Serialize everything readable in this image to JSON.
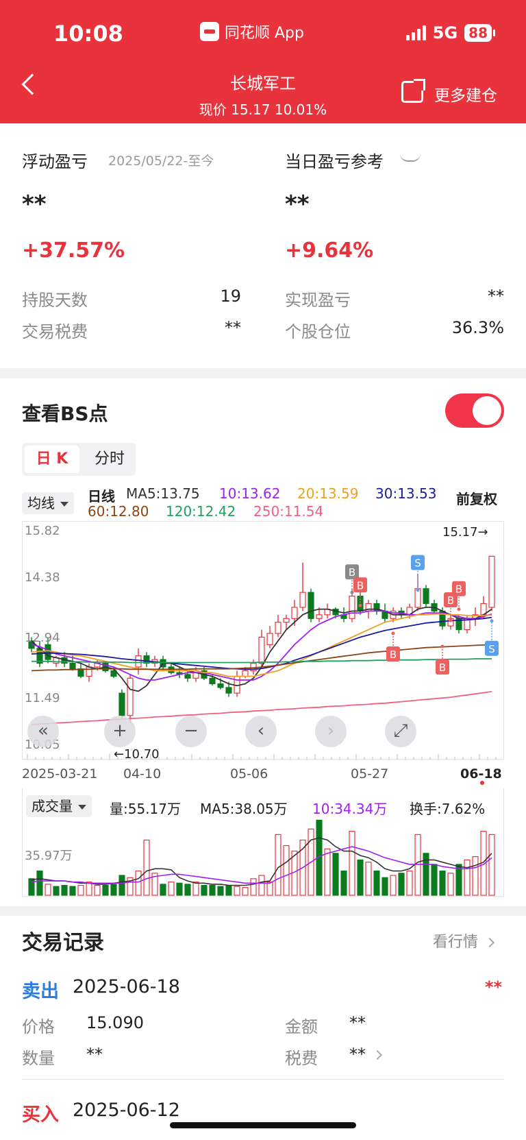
{
  "status": {
    "time": "10:08",
    "app": "同花顺 App",
    "network": "5G",
    "battery": "88"
  },
  "header": {
    "title": "长城军工",
    "subtitle": "现价 15.17 10.01%",
    "more_label": "更多建仓"
  },
  "summary": {
    "float_label": "浮动盈亏",
    "float_period": "2025/05/22-至今",
    "float_value": "**",
    "float_pct": "+37.57%",
    "daily_label": "当日盈亏参考",
    "daily_value": "**",
    "daily_pct": "+9.64%",
    "rows": [
      {
        "label": "持股天数",
        "value": "19",
        "label2": "实现盈亏",
        "value2": "**"
      },
      {
        "label": "交易税费",
        "value": "**",
        "label2": "个股仓位",
        "value2": "36.3%"
      }
    ]
  },
  "bs": {
    "title": "查看BS点",
    "toggle_on": true
  },
  "tabs": [
    {
      "label": "日 K",
      "active": true
    },
    {
      "label": "分时",
      "active": false
    }
  ],
  "kline": {
    "indicator": "均线",
    "line_label": "日线",
    "adjust": "前复权",
    "ma": [
      {
        "label": "MA5:13.75",
        "color": "#333333"
      },
      {
        "label": "10:13.62",
        "color": "#a020f0"
      },
      {
        "label": "20:13.59",
        "color": "#f0a020"
      },
      {
        "label": "30:13.53",
        "color": "#1a1aa0"
      },
      {
        "label": "60:12.80",
        "color": "#8b4513"
      },
      {
        "label": "120:12.42",
        "color": "#20a060"
      },
      {
        "label": "250:11.54",
        "color": "#f06080"
      }
    ],
    "price_ticks": [
      "15.82",
      "14.38",
      "12.94",
      "11.49",
      "10.05"
    ],
    "high_label": "15.17→",
    "low_label": "←10.70",
    "dates": [
      "2025-03-21",
      "04-10",
      "05-06",
      "05-27",
      "06-18"
    ]
  },
  "chart_data": {
    "type": "candlestick",
    "title": "",
    "xlabel": "",
    "ylabel": "",
    "ylim": [
      10.05,
      15.82
    ],
    "candles": [
      {
        "o": 12.9,
        "h": 13.0,
        "l": 12.6,
        "c": 12.7
      },
      {
        "o": 12.7,
        "h": 12.9,
        "l": 12.2,
        "c": 12.3
      },
      {
        "o": 12.8,
        "h": 13.0,
        "l": 12.3,
        "c": 12.4
      },
      {
        "o": 12.3,
        "h": 12.5,
        "l": 12.2,
        "c": 12.45
      },
      {
        "o": 12.45,
        "h": 12.6,
        "l": 12.2,
        "c": 12.3
      },
      {
        "o": 12.3,
        "h": 12.5,
        "l": 12.1,
        "c": 12.15
      },
      {
        "o": 12.15,
        "h": 12.3,
        "l": 11.9,
        "c": 11.95
      },
      {
        "o": 11.95,
        "h": 12.3,
        "l": 11.8,
        "c": 12.2
      },
      {
        "o": 12.2,
        "h": 12.4,
        "l": 12.1,
        "c": 12.3
      },
      {
        "o": 12.3,
        "h": 12.35,
        "l": 12.05,
        "c": 12.1
      },
      {
        "o": 12.1,
        "h": 12.2,
        "l": 11.9,
        "c": 11.95
      },
      {
        "o": 11.5,
        "h": 11.6,
        "l": 10.8,
        "c": 10.9
      },
      {
        "o": 10.9,
        "h": 12.0,
        "l": 10.7,
        "c": 11.9
      },
      {
        "o": 12.2,
        "h": 12.7,
        "l": 12.0,
        "c": 12.5
      },
      {
        "o": 12.5,
        "h": 12.6,
        "l": 12.2,
        "c": 12.3
      },
      {
        "o": 12.3,
        "h": 12.5,
        "l": 12.2,
        "c": 12.4
      },
      {
        "o": 12.4,
        "h": 12.5,
        "l": 12.1,
        "c": 12.2
      },
      {
        "o": 12.2,
        "h": 12.3,
        "l": 12.0,
        "c": 12.05
      },
      {
        "o": 12.05,
        "h": 12.2,
        "l": 11.9,
        "c": 12.0
      },
      {
        "o": 12.0,
        "h": 12.1,
        "l": 11.8,
        "c": 11.9
      },
      {
        "o": 11.9,
        "h": 12.2,
        "l": 11.8,
        "c": 12.1
      },
      {
        "o": 12.1,
        "h": 12.2,
        "l": 11.85,
        "c": 11.9
      },
      {
        "o": 11.9,
        "h": 12.0,
        "l": 11.7,
        "c": 11.75
      },
      {
        "o": 11.75,
        "h": 11.9,
        "l": 11.6,
        "c": 11.65
      },
      {
        "o": 11.65,
        "h": 11.8,
        "l": 11.4,
        "c": 11.5
      },
      {
        "o": 11.5,
        "h": 12.1,
        "l": 11.4,
        "c": 11.95
      },
      {
        "o": 11.95,
        "h": 12.2,
        "l": 11.9,
        "c": 12.1
      },
      {
        "o": 12.1,
        "h": 12.4,
        "l": 12.0,
        "c": 12.3
      },
      {
        "o": 12.3,
        "h": 13.2,
        "l": 12.2,
        "c": 13.0
      },
      {
        "o": 12.8,
        "h": 13.3,
        "l": 12.7,
        "c": 13.1
      },
      {
        "o": 13.1,
        "h": 13.6,
        "l": 13.0,
        "c": 13.4
      },
      {
        "o": 13.4,
        "h": 13.6,
        "l": 13.2,
        "c": 13.5
      },
      {
        "o": 13.5,
        "h": 14.0,
        "l": 13.3,
        "c": 13.8
      },
      {
        "o": 13.8,
        "h": 15.0,
        "l": 13.7,
        "c": 14.2
      },
      {
        "o": 14.2,
        "h": 14.3,
        "l": 13.4,
        "c": 13.5
      },
      {
        "o": 13.5,
        "h": 13.8,
        "l": 13.4,
        "c": 13.6
      },
      {
        "o": 13.6,
        "h": 13.9,
        "l": 13.5,
        "c": 13.75
      },
      {
        "o": 13.75,
        "h": 13.8,
        "l": 13.5,
        "c": 13.6
      },
      {
        "o": 13.6,
        "h": 13.8,
        "l": 13.4,
        "c": 13.5
      },
      {
        "o": 13.5,
        "h": 14.3,
        "l": 13.4,
        "c": 14.1
      },
      {
        "o": 14.1,
        "h": 14.3,
        "l": 13.6,
        "c": 13.7
      },
      {
        "o": 13.7,
        "h": 14.0,
        "l": 13.5,
        "c": 13.9
      },
      {
        "o": 13.9,
        "h": 14.0,
        "l": 13.6,
        "c": 13.7
      },
      {
        "o": 13.7,
        "h": 13.9,
        "l": 13.4,
        "c": 13.5
      },
      {
        "o": 13.5,
        "h": 13.8,
        "l": 13.4,
        "c": 13.7
      },
      {
        "o": 13.7,
        "h": 13.8,
        "l": 13.5,
        "c": 13.6
      },
      {
        "o": 13.6,
        "h": 13.9,
        "l": 13.5,
        "c": 13.8
      },
      {
        "o": 13.8,
        "h": 14.7,
        "l": 13.7,
        "c": 14.3
      },
      {
        "o": 14.3,
        "h": 14.4,
        "l": 13.8,
        "c": 13.9
      },
      {
        "o": 13.9,
        "h": 14.0,
        "l": 13.6,
        "c": 13.7
      },
      {
        "o": 13.7,
        "h": 13.8,
        "l": 13.2,
        "c": 13.3
      },
      {
        "o": 13.3,
        "h": 13.6,
        "l": 13.2,
        "c": 13.5
      },
      {
        "o": 13.5,
        "h": 13.6,
        "l": 13.1,
        "c": 13.2
      },
      {
        "o": 13.2,
        "h": 13.6,
        "l": 13.1,
        "c": 13.5
      },
      {
        "o": 13.5,
        "h": 13.8,
        "l": 13.3,
        "c": 13.6
      },
      {
        "o": 13.6,
        "h": 14.1,
        "l": 13.5,
        "c": 13.9
      },
      {
        "o": 13.8,
        "h": 15.17,
        "l": 13.7,
        "c": 15.17
      }
    ],
    "ma_series": [
      {
        "name": "MA5",
        "color": "#333333",
        "values": [
          12.9,
          12.7,
          12.5,
          12.45,
          12.4,
          12.35,
          12.3,
          12.2,
          12.15,
          12.2,
          12.15,
          11.9,
          11.6,
          11.55,
          11.7,
          12.0,
          12.3,
          12.3,
          12.2,
          12.1,
          12.05,
          12.0,
          11.95,
          11.85,
          11.75,
          11.7,
          11.75,
          11.9,
          12.2,
          12.6,
          12.9,
          13.2,
          13.4,
          13.6,
          13.7,
          13.75,
          13.75,
          13.7,
          13.65,
          13.7,
          13.7,
          13.75,
          13.75,
          13.7,
          13.6,
          13.6,
          13.6,
          13.75,
          13.8,
          13.8,
          13.7,
          13.6,
          13.5,
          13.5,
          13.5,
          13.6,
          13.75
        ]
      },
      {
        "name": "10",
        "color": "#a020f0",
        "values": [
          12.8,
          12.75,
          12.65,
          12.55,
          12.5,
          12.45,
          12.4,
          12.35,
          12.3,
          12.25,
          12.2,
          12.1,
          12.0,
          11.9,
          11.85,
          11.85,
          11.9,
          11.95,
          12.0,
          12.05,
          12.05,
          12.05,
          12.0,
          11.95,
          11.9,
          11.85,
          11.85,
          11.85,
          11.95,
          12.1,
          12.3,
          12.55,
          12.8,
          13.0,
          13.2,
          13.35,
          13.45,
          13.55,
          13.6,
          13.65,
          13.65,
          13.7,
          13.7,
          13.7,
          13.65,
          13.65,
          13.6,
          13.6,
          13.65,
          13.65,
          13.65,
          13.6,
          13.55,
          13.5,
          13.5,
          13.55,
          13.62
        ]
      },
      {
        "name": "20",
        "color": "#f0a020",
        "values": [
          12.6,
          12.62,
          12.64,
          12.6,
          12.55,
          12.52,
          12.5,
          12.45,
          12.4,
          12.35,
          12.3,
          12.25,
          12.2,
          12.15,
          12.15,
          12.1,
          12.1,
          12.1,
          12.1,
          12.1,
          12.1,
          12.05,
          12.05,
          12.0,
          11.95,
          11.95,
          11.95,
          11.95,
          12.0,
          12.05,
          12.1,
          12.2,
          12.3,
          12.4,
          12.5,
          12.6,
          12.7,
          12.8,
          12.9,
          13.0,
          13.1,
          13.2,
          13.3,
          13.4,
          13.45,
          13.5,
          13.55,
          13.6,
          13.6,
          13.62,
          13.62,
          13.6,
          13.6,
          13.58,
          13.57,
          13.58,
          13.59
        ]
      },
      {
        "name": "30",
        "color": "#1a1aa0",
        "values": [
          12.55,
          12.56,
          12.57,
          12.57,
          12.56,
          12.55,
          12.54,
          12.52,
          12.5,
          12.48,
          12.45,
          12.42,
          12.4,
          12.38,
          12.36,
          12.34,
          12.32,
          12.3,
          12.28,
          12.26,
          12.24,
          12.22,
          12.2,
          12.18,
          12.16,
          12.15,
          12.14,
          12.14,
          12.16,
          12.2,
          12.25,
          12.3,
          12.38,
          12.45,
          12.52,
          12.6,
          12.68,
          12.76,
          12.84,
          12.92,
          13.0,
          13.06,
          13.12,
          13.18,
          13.22,
          13.26,
          13.3,
          13.34,
          13.38,
          13.4,
          13.42,
          13.44,
          13.45,
          13.46,
          13.48,
          13.5,
          13.53
        ]
      },
      {
        "name": "60",
        "color": "#8b4513",
        "values": [
          12.1,
          12.11,
          12.12,
          12.12,
          12.13,
          12.13,
          12.14,
          12.14,
          12.15,
          12.15,
          12.15,
          12.15,
          12.14,
          12.14,
          12.14,
          12.14,
          12.14,
          12.14,
          12.14,
          12.14,
          12.15,
          12.15,
          12.15,
          12.15,
          12.15,
          12.16,
          12.17,
          12.18,
          12.2,
          12.22,
          12.25,
          12.28,
          12.31,
          12.34,
          12.37,
          12.4,
          12.43,
          12.46,
          12.49,
          12.52,
          12.55,
          12.58,
          12.6,
          12.62,
          12.64,
          12.66,
          12.68,
          12.7,
          12.72,
          12.73,
          12.74,
          12.75,
          12.76,
          12.77,
          12.78,
          12.79,
          12.8
        ]
      },
      {
        "name": "120",
        "color": "#20a060",
        "values": [
          12.35,
          12.35,
          12.35,
          12.34,
          12.34,
          12.34,
          12.34,
          12.33,
          12.33,
          12.33,
          12.33,
          12.33,
          12.32,
          12.32,
          12.32,
          12.32,
          12.32,
          12.32,
          12.32,
          12.32,
          12.32,
          12.32,
          12.32,
          12.32,
          12.32,
          12.32,
          12.32,
          12.32,
          12.33,
          12.33,
          12.33,
          12.34,
          12.34,
          12.35,
          12.35,
          12.35,
          12.36,
          12.36,
          12.36,
          12.37,
          12.37,
          12.37,
          12.38,
          12.38,
          12.38,
          12.39,
          12.39,
          12.39,
          12.4,
          12.4,
          12.4,
          12.41,
          12.41,
          12.41,
          12.42,
          12.42,
          12.42
        ]
      },
      {
        "name": "250",
        "color": "#f06080",
        "values": [
          10.65,
          10.67,
          10.68,
          10.7,
          10.71,
          10.72,
          10.74,
          10.75,
          10.76,
          10.78,
          10.79,
          10.8,
          10.82,
          10.83,
          10.84,
          10.86,
          10.87,
          10.88,
          10.9,
          10.91,
          10.92,
          10.94,
          10.95,
          10.96,
          10.98,
          10.99,
          11.0,
          11.02,
          11.03,
          11.04,
          11.06,
          11.07,
          11.08,
          11.1,
          11.11,
          11.12,
          11.14,
          11.15,
          11.16,
          11.18,
          11.19,
          11.2,
          11.22,
          11.23,
          11.25,
          11.27,
          11.29,
          11.31,
          11.33,
          11.35,
          11.37,
          11.39,
          11.42,
          11.45,
          11.48,
          11.51,
          11.54
        ]
      }
    ],
    "bs_marks": [
      {
        "index": 39,
        "type": "B",
        "price": 14.75,
        "gray": true
      },
      {
        "index": 40,
        "type": "B",
        "price": 14.4,
        "gray": false
      },
      {
        "index": 44,
        "type": "B",
        "price": 12.55,
        "gray": false
      },
      {
        "index": 47,
        "type": "S",
        "price": 15.0,
        "gray": false
      },
      {
        "index": 50,
        "type": "B",
        "price": 12.2,
        "gray": false
      },
      {
        "index": 51,
        "type": "B",
        "price": 14.0,
        "gray": false
      },
      {
        "index": 52,
        "type": "B",
        "price": 14.3,
        "gray": false
      },
      {
        "index": 56,
        "type": "S",
        "price": 12.7,
        "gray": false
      }
    ],
    "volume": {
      "indicator": "成交量",
      "vol_label": "量:55.17万",
      "ma5_label": "MA5:38.05万",
      "ma10_label": "10:34.34万",
      "turnover_label": "换手:7.62%",
      "tick": "35.97万",
      "ylim": [
        0,
        72
      ],
      "values": [
        15,
        22,
        10,
        8,
        9,
        8,
        9,
        12,
        9,
        9,
        10,
        18,
        16,
        22,
        50,
        20,
        10,
        12,
        11,
        10,
        12,
        9,
        9,
        8,
        9,
        8,
        7,
        15,
        18,
        12,
        55,
        45,
        40,
        50,
        60,
        68,
        42,
        38,
        22,
        58,
        32,
        30,
        22,
        16,
        18,
        20,
        22,
        55,
        38,
        28,
        22,
        20,
        28,
        32,
        35,
        58,
        55
      ],
      "up": [
        false,
        false,
        true,
        false,
        false,
        false,
        true,
        true,
        true,
        false,
        false,
        false,
        true,
        true,
        true,
        true,
        false,
        true,
        false,
        false,
        true,
        false,
        false,
        false,
        false,
        true,
        true,
        true,
        true,
        true,
        true,
        true,
        true,
        true,
        true,
        false,
        true,
        false,
        false,
        true,
        false,
        true,
        false,
        false,
        true,
        false,
        true,
        true,
        false,
        false,
        false,
        true,
        false,
        true,
        true,
        true,
        true
      ],
      "ma5": [
        14,
        15,
        14,
        13,
        13,
        12,
        11,
        11,
        10,
        10,
        11,
        12,
        13,
        15,
        22,
        24,
        24,
        23,
        16,
        13,
        11,
        11,
        10,
        10,
        9,
        9,
        9,
        10,
        12,
        13,
        25,
        30,
        36,
        42,
        50,
        52,
        50,
        44,
        40,
        40,
        36,
        34,
        30,
        24,
        22,
        22,
        24,
        30,
        32,
        32,
        30,
        28,
        26,
        25,
        27,
        30,
        38
      ],
      "ma10": [
        12,
        13,
        13,
        13,
        13,
        12,
        12,
        11,
        11,
        11,
        11,
        11,
        12,
        12,
        15,
        17,
        18,
        19,
        19,
        18,
        17,
        16,
        15,
        14,
        13,
        12,
        11,
        11,
        11,
        11,
        15,
        18,
        21,
        25,
        30,
        35,
        38,
        40,
        42,
        44,
        42,
        40,
        37,
        34,
        32,
        30,
        28,
        28,
        28,
        28,
        26,
        25,
        24,
        24,
        25,
        28,
        34
      ]
    }
  },
  "records": {
    "title": "交易记录",
    "more": "看行情",
    "items": [
      {
        "side": "卖出",
        "date": "2025-06-18",
        "amount_flag": "**",
        "price_label": "价格",
        "price": "15.090",
        "money_label": "金额",
        "money": "**",
        "qty_label": "数量",
        "qty": "**",
        "tax_label": "税费",
        "tax": "**"
      },
      {
        "side": "买入",
        "date": "2025-06-12"
      }
    ]
  },
  "colors": {
    "brand": "#e8333c",
    "up": "#e8333c",
    "down": "#0c7a1e",
    "sell": "#2a7ee0"
  }
}
